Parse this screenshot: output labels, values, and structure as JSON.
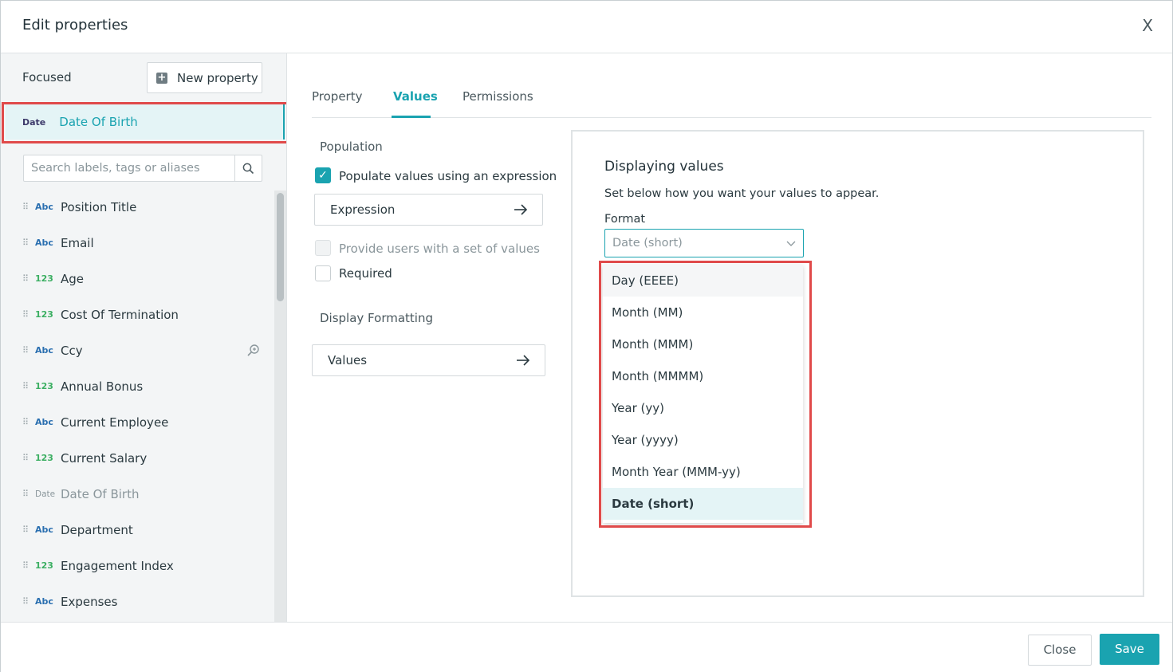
{
  "dialog": {
    "title": "Edit properties",
    "close_icon": "X"
  },
  "sidebar": {
    "focused_label": "Focused",
    "new_property_label": "New property",
    "selected": {
      "type": "Date",
      "label": "Date Of Birth"
    },
    "search_placeholder": "Search labels, tags or aliases",
    "items": [
      {
        "type": "Abc",
        "label": "Position Title"
      },
      {
        "type": "Abc",
        "label": "Email"
      },
      {
        "type": "123",
        "label": "Age"
      },
      {
        "type": "123",
        "label": "Cost Of Termination"
      },
      {
        "type": "Abc",
        "label": "Ccy"
      },
      {
        "type": "123",
        "label": "Annual Bonus"
      },
      {
        "type": "Abc",
        "label": "Current Employee"
      },
      {
        "type": "123",
        "label": "Current Salary"
      },
      {
        "type": "Date",
        "label": "Date Of Birth"
      },
      {
        "type": "Abc",
        "label": "Department"
      },
      {
        "type": "123",
        "label": "Engagement Index"
      },
      {
        "type": "Abc",
        "label": "Expenses"
      }
    ]
  },
  "tabs": [
    "Property",
    "Values",
    "Permissions"
  ],
  "values_tab": {
    "population_title": "Population",
    "populate_expression_label": "Populate values using an expression",
    "expression_button": "Expression",
    "provide_values_label": "Provide users with a set of values",
    "required_label": "Required",
    "display_formatting_title": "Display Formatting",
    "values_button": "Values"
  },
  "display_panel": {
    "heading": "Displaying values",
    "description": "Set below how you want your values to appear.",
    "format_label": "Format",
    "format_value": "Date (short)",
    "options": [
      "Day (EEEE)",
      "Month (MM)",
      "Month (MMM)",
      "Month (MMMM)",
      "Year (yy)",
      "Year (yyyy)",
      "Month Year (MMM-yy)",
      "Date (short)"
    ]
  },
  "footer": {
    "close_label": "Close",
    "save_label": "Save"
  },
  "colors": {
    "accent": "#1aa3b0",
    "highlight": "#e04a4a"
  }
}
